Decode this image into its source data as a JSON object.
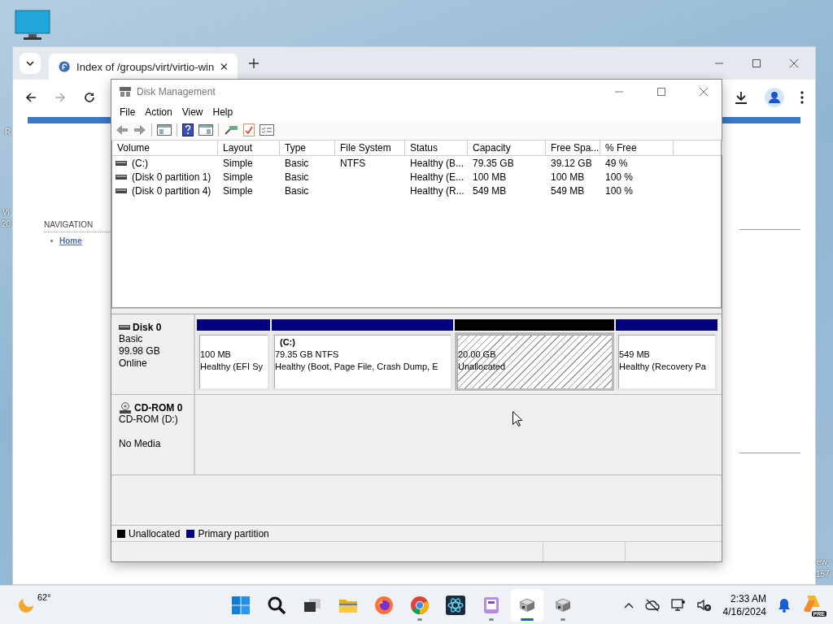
{
  "desktop": {
    "edge_labels": [
      {
        "text": "R"
      },
      {
        "text": "Vi"
      },
      {
        "text": "20"
      },
      {
        "text": "ew"
      },
      {
        "text": "157"
      }
    ]
  },
  "browser": {
    "tabs": [
      {
        "title": "Index of /groups/virt/virtio-win",
        "selected": true
      }
    ],
    "page": {
      "navigation_heading": "NAVIGATION",
      "links": [
        "Home"
      ]
    }
  },
  "disk_management": {
    "title": "Disk Management",
    "menu": [
      "File",
      "Action",
      "View",
      "Help"
    ],
    "volume_table": {
      "columns": [
        "Volume",
        "Layout",
        "Type",
        "File System",
        "Status",
        "Capacity",
        "Free Spa...",
        "% Free"
      ],
      "rows": [
        [
          "(C:)",
          "Simple",
          "Basic",
          "NTFS",
          "Healthy (B...",
          "79.35 GB",
          "39.12 GB",
          "49 %"
        ],
        [
          "(Disk 0 partition 1)",
          "Simple",
          "Basic",
          "",
          "Healthy (E...",
          "100 MB",
          "100 MB",
          "100 %"
        ],
        [
          "(Disk 0 partition 4)",
          "Simple",
          "Basic",
          "",
          "Healthy (R...",
          "549 MB",
          "549 MB",
          "100 %"
        ]
      ]
    },
    "disks": [
      {
        "kind": "disk",
        "name": "Disk 0",
        "type": "Basic",
        "size": "99.98 GB",
        "status": "Online",
        "partitions": [
          {
            "kind": "primary",
            "size": "100 MB",
            "status": "Healthy (EFI Sy"
          },
          {
            "kind": "primary",
            "label": "(C:)",
            "size": "79.35 GB NTFS",
            "status": "Healthy (Boot, Page File, Crash Dump, E"
          },
          {
            "kind": "unallocated",
            "size": "20.00 GB",
            "status": "Unallocated"
          },
          {
            "kind": "primary",
            "size": "549 MB",
            "status": "Healthy (Recovery Pa"
          }
        ]
      },
      {
        "kind": "cdrom",
        "name": "CD-ROM 0",
        "type": "CD-ROM (D:)",
        "status": "No Media"
      }
    ],
    "legend": [
      {
        "kind": "unallocated",
        "label": "Unallocated",
        "color": "#000000"
      },
      {
        "kind": "primary",
        "label": "Primary partition",
        "color": "#000080"
      }
    ]
  },
  "taskbar": {
    "weather": "62°",
    "apps": [
      {
        "kind": "start",
        "running": false,
        "selected": false
      },
      {
        "kind": "search",
        "running": false,
        "selected": false
      },
      {
        "kind": "taskview",
        "running": false,
        "selected": false
      },
      {
        "kind": "folder",
        "running": false,
        "selected": false
      },
      {
        "kind": "firefox",
        "running": false,
        "selected": false
      },
      {
        "kind": "chrome",
        "running": true,
        "selected": false
      },
      {
        "kind": "atom",
        "running": false,
        "selected": false
      },
      {
        "kind": "purple",
        "running": true,
        "selected": false
      },
      {
        "kind": "disk",
        "running": true,
        "selected": true
      },
      {
        "kind": "disk",
        "running": true,
        "selected": false
      }
    ],
    "time": "2:33 AM",
    "date": "4/16/2024",
    "badge": "PRE"
  }
}
